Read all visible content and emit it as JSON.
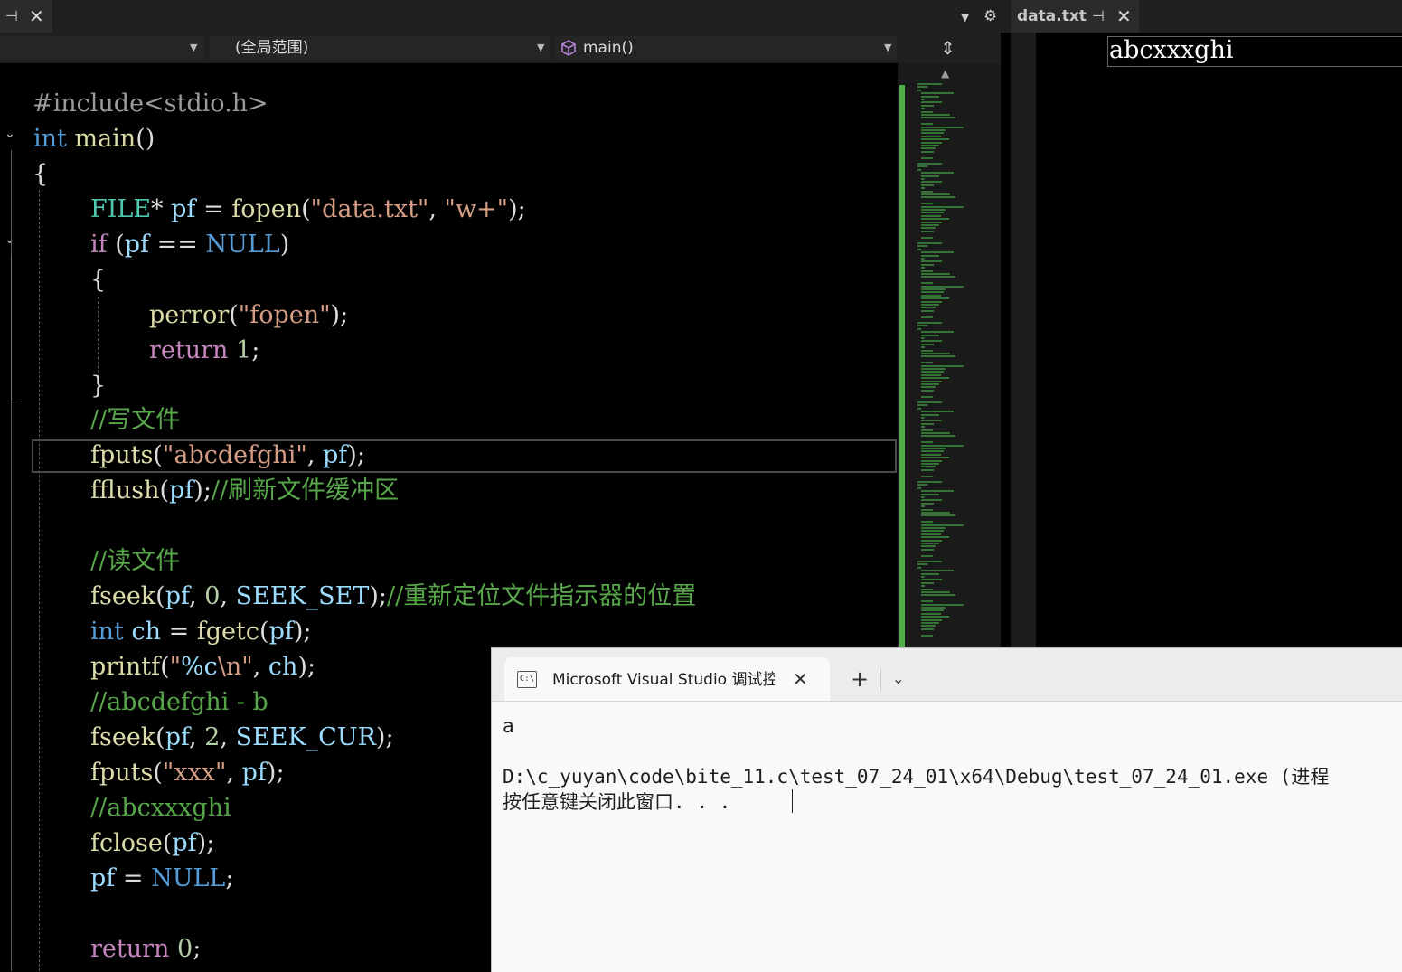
{
  "tabs": {
    "left_pin": "⊣",
    "left_close": "✕",
    "dropdown": "▼",
    "settings": "⚙",
    "right_tab_label": "data.txt",
    "right_pin": "⊣",
    "right_close": "✕"
  },
  "navbar": {
    "project_combo": "",
    "scope_combo": "(全局范围)",
    "member_combo": "main()",
    "split_button": "⇕"
  },
  "editor": {
    "lines": [
      "#include<stdio.h>",
      "int main()",
      "{",
      "FILE* pf = fopen(\"data.txt\", \"w+\");",
      "if (pf == NULL)",
      "{",
      "perror(\"fopen\");",
      "return 1;",
      "}",
      "//写文件",
      "fputs(\"abcdefghi\", pf);",
      "fflush(pf);//刷新文件缓冲区",
      "",
      "//读文件",
      "fseek(pf, 0, SEEK_SET);//重新定位文件指示器的位置",
      "int ch = fgetc(pf);",
      "printf(\"%c\\n\", ch);",
      "//abcdefghi - b",
      "fseek(pf, 2, SEEK_CUR);",
      "fputs(\"xxx\", pf);",
      "//abcxxxghi",
      "fclose(pf);",
      "pf = NULL;",
      "",
      "return 0;"
    ],
    "fold_markers": [
      "⌄",
      "⌄"
    ]
  },
  "data_file": {
    "content": "abcxxxghi"
  },
  "console": {
    "tab_icon": "C:\\",
    "tab_title": "Microsoft Visual Studio 调试控制台",
    "tab_close": "✕",
    "new_tab": "+",
    "dropdown": "⌄",
    "output_lines": [
      "a",
      "",
      "D:\\c_yuyan\\code\\bite_11.c\\test_07_24_01\\x64\\Debug\\test_07_24_01.exe (进程",
      "按任意键关闭此窗口. . ."
    ]
  },
  "colors": {
    "keyword": "#569cd6",
    "type": "#4ec9b0",
    "identifier": "#9cdcfe",
    "function": "#dcdcaa",
    "string": "#d69d85",
    "comment": "#57a64a",
    "control": "#c586c0",
    "number": "#b5cea8",
    "preprocessor": "#9b9b9b",
    "change_bar": "#4fb04a"
  }
}
